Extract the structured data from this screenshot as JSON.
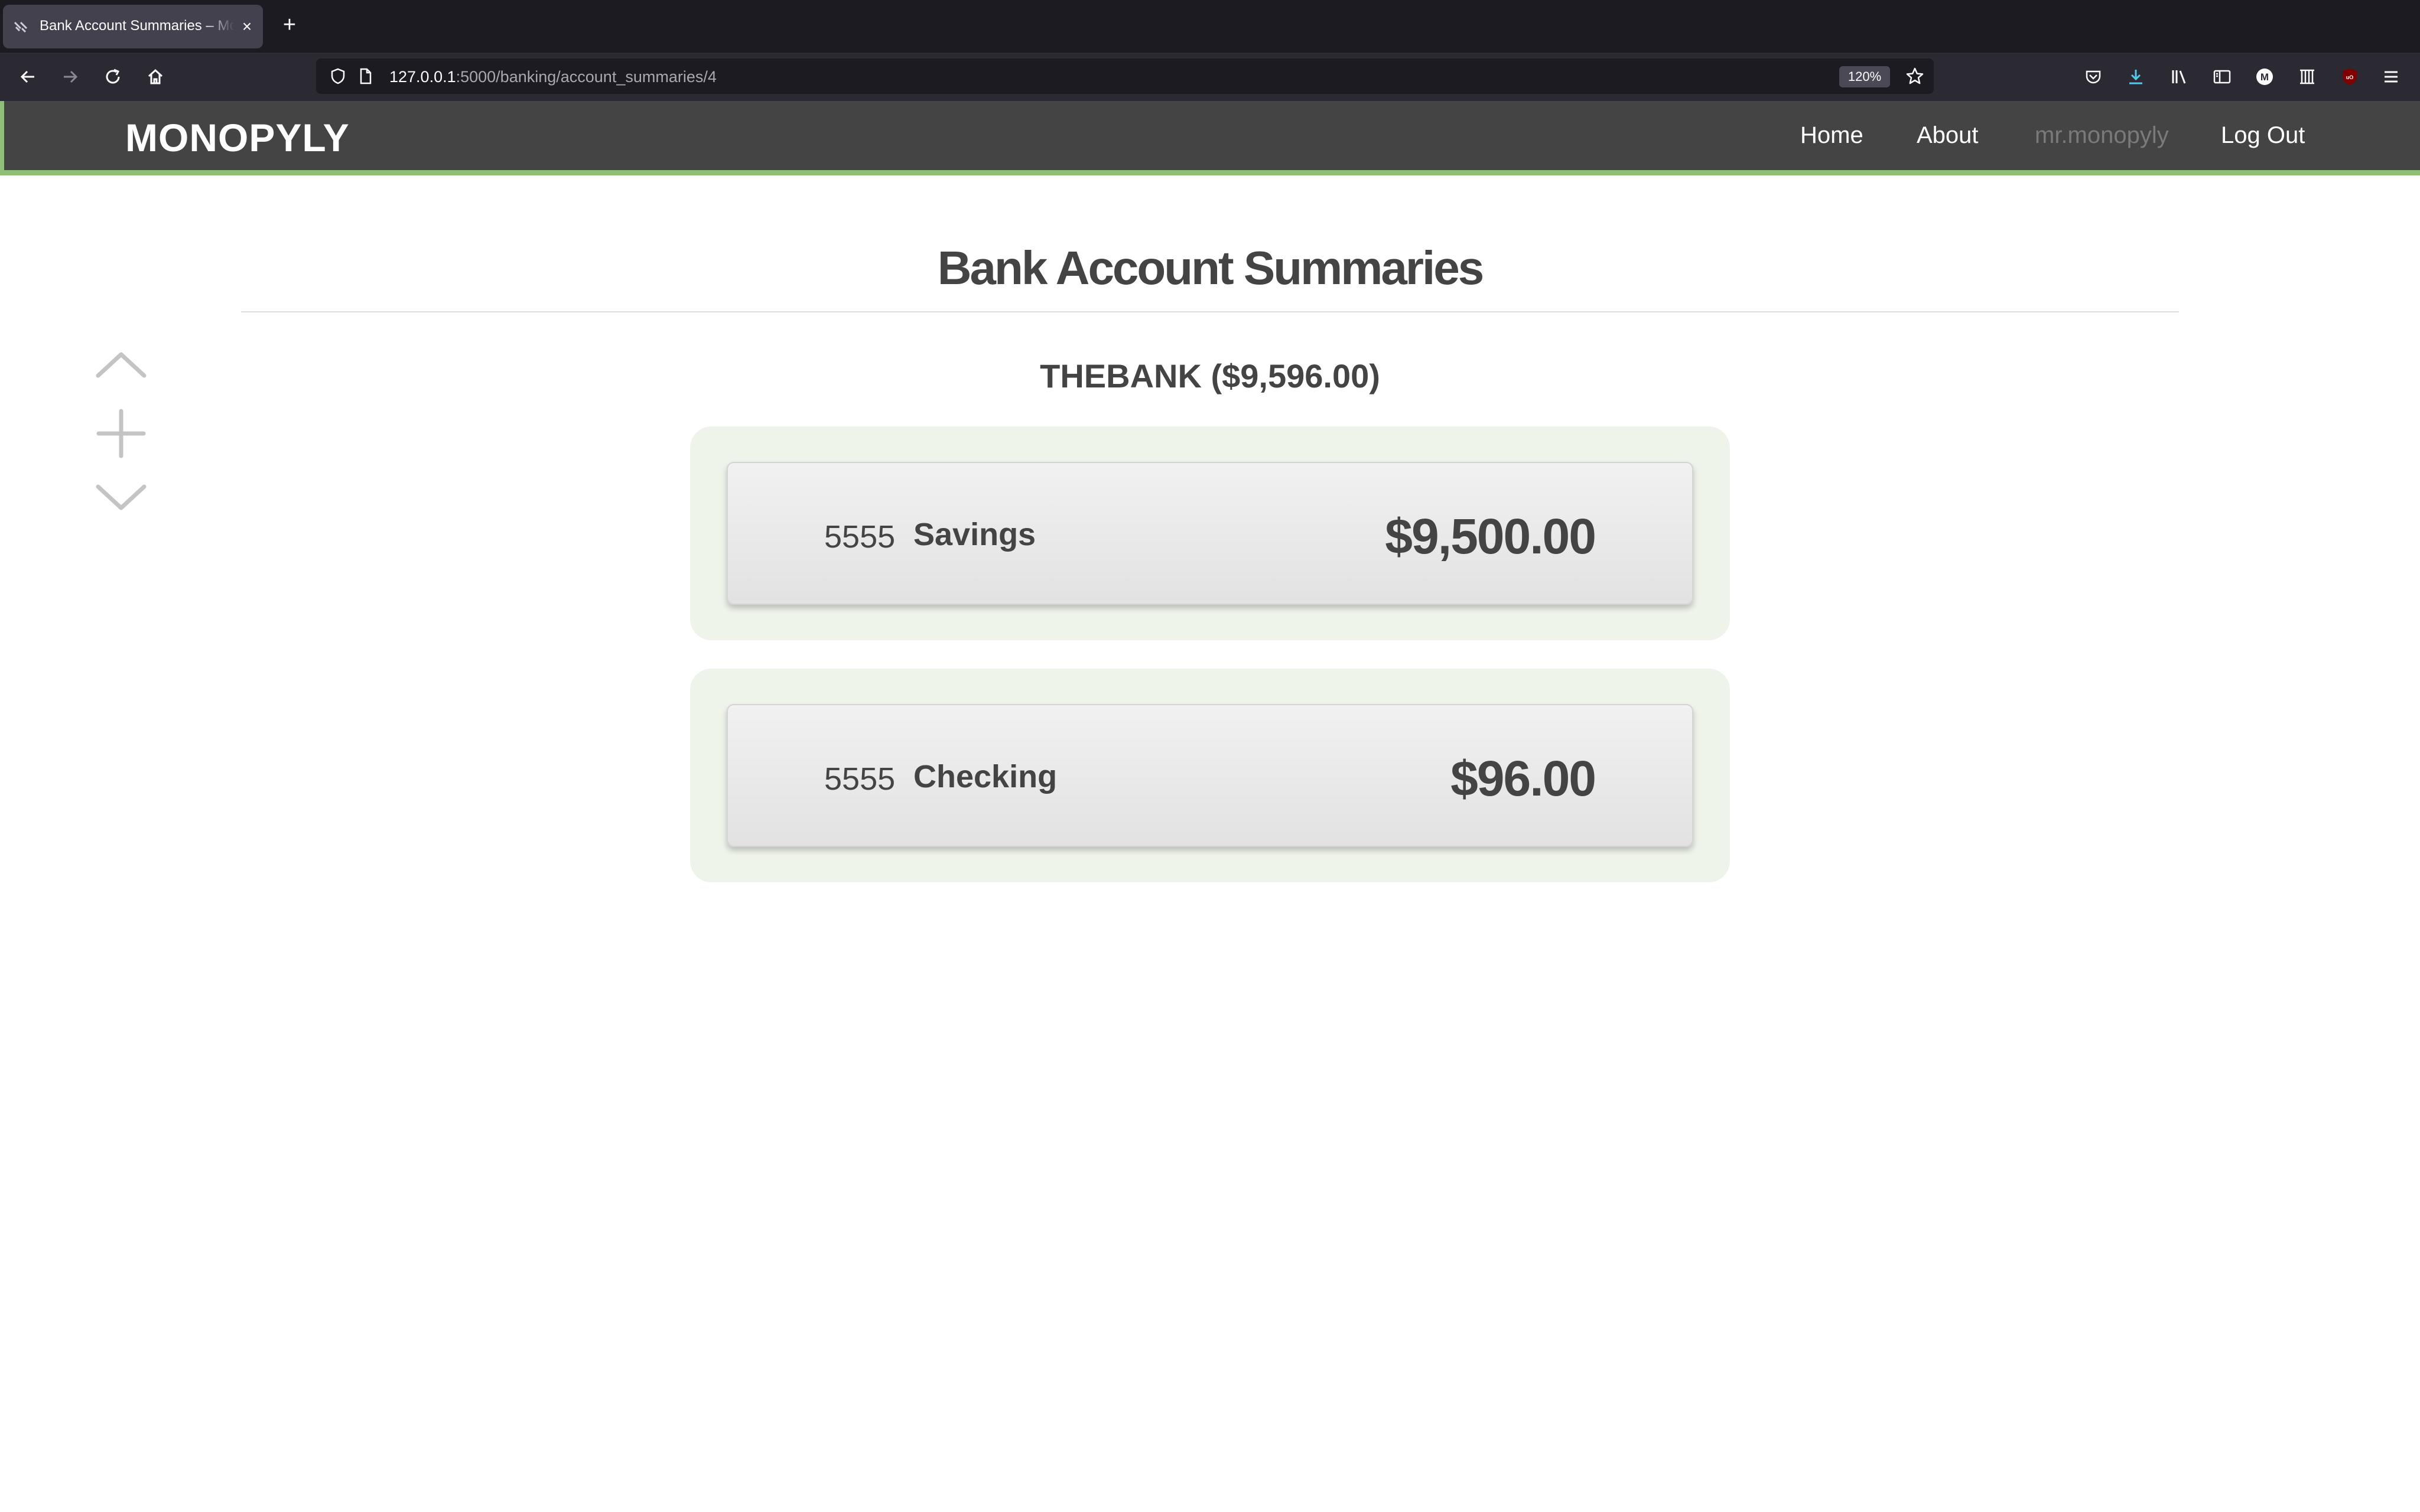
{
  "browser": {
    "tab_title": "Bank Account Summaries – Monopyly",
    "url_host": "127.0.0.1",
    "url_path": ":5000/banking/account_summaries/4",
    "zoom_level": "120%"
  },
  "navbar": {
    "brand": "MONOPYLY",
    "links": [
      "Home",
      "About",
      "mr.monopyly",
      "Log Out"
    ]
  },
  "page": {
    "title": "Bank Account Summaries",
    "bank_header": "THEBANK ($9,596.00)",
    "accounts": [
      {
        "number": "5555",
        "type": "Savings",
        "balance": "$9,500.00"
      },
      {
        "number": "5555",
        "type": "Checking",
        "balance": "$96.00"
      }
    ]
  },
  "icons": {
    "side_controls": [
      "chevron-up-icon",
      "plus-icon",
      "chevron-down-icon"
    ]
  },
  "colors": {
    "navbar_bg": "#444444",
    "accent_green": "#8fbf76",
    "group_bg": "#eff4ea",
    "text_dark": "#444444"
  }
}
